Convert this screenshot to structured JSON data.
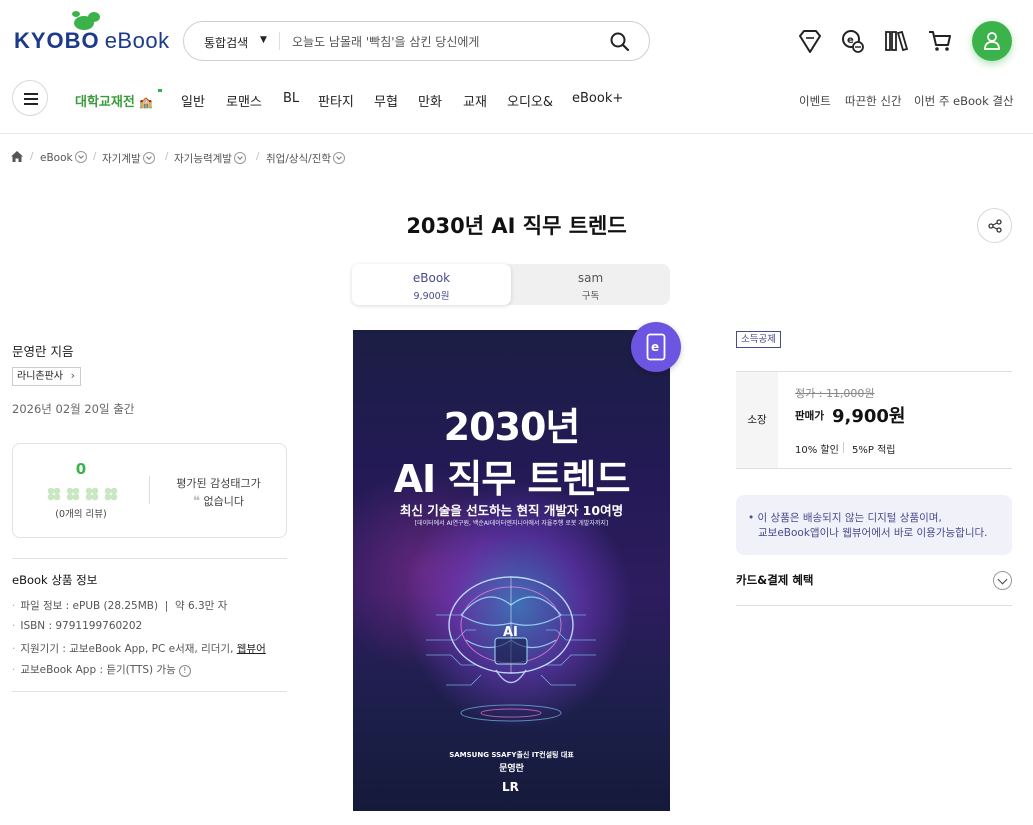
{
  "header": {
    "logo_brand": "KYOBO",
    "logo_product": "eBook",
    "search": {
      "category": "통합검색",
      "placeholder": "오늘도 남몰래 '빡침'을 삼킨 당신에게"
    },
    "icons": [
      "bookmark-ribbon-icon",
      "ecash-coin-icon",
      "library-icon",
      "cart-icon",
      "user-icon"
    ]
  },
  "nav": {
    "items": [
      "대학교재전",
      "일반",
      "로맨스",
      "BL",
      "판타지",
      "무협",
      "만화",
      "교재",
      "오디오&",
      "eBook+"
    ],
    "right_links": [
      "이벤트",
      "따끈한 신간",
      "이번 주 eBook 결산"
    ]
  },
  "breadcrumb": [
    "eBook",
    "자기계발",
    "자기능력계발",
    "취업/상식/진학"
  ],
  "product": {
    "title": "2030년 AI 직무 트렌드",
    "tabs": [
      {
        "label": "eBook",
        "sub": "9,900원"
      },
      {
        "label": "sam",
        "sub": "구독"
      }
    ],
    "author": "문영란 지음",
    "publisher": "라니촌판사",
    "pub_date": "2026년 02월 20일 출간",
    "review": {
      "score": "0",
      "rating_stars": 0,
      "count_text": "(0개의 리뷰)",
      "tag_line1": "평가된 감성태그가",
      "tag_line2": "없습니다"
    },
    "info": {
      "title": "eBook 상품 정보",
      "file": "파일 정보 : ePUB (28.25MB)",
      "file_chars": "약 6.3만 자",
      "isbn": "ISBN : 9791199760202",
      "devices_prefix": "지원기기 : 교보eBook App, PC e서재, 리더기,",
      "devices_link": "웹뷰어",
      "tts": "교보eBook App : 듣기(TTS) 가능"
    },
    "cover": {
      "line1": "2030년",
      "line2": "AI 직무 트렌드",
      "subtitle": "최신 기술을 선도하는 현직 개발자 10여명",
      "subtitle2": "[데이터에서 AI연구원, 백순AI데이터엔지니어에서 자율주행 로봇 개발자까지]",
      "ai_label": "AI",
      "author_line1": "SAMSUNG SSAFY출신 IT컨설팅 대표",
      "author_line2": "문영란",
      "publisher_mark": "LR"
    },
    "price": {
      "tax_badge": "소득공제",
      "own_label": "소장",
      "original": "정가 : 11,000원",
      "sale_label": "판매가",
      "sale": "9,900원",
      "discount": "10% 할인",
      "points": "5%P 적립"
    },
    "notice": {
      "line1": "• 이 상품은 배송되지 않는 디지털 상품이며,",
      "line2": "교보eBook앱이나 웹뷰어에서 바로 이용가능합니다."
    },
    "card_benefit": "카드&결제 혜택"
  },
  "colors": {
    "brand_blue": "#1b3a8c",
    "brand_green": "#3cb34a",
    "accent_purple": "#6c55e0",
    "accent_navy": "#4a4a8c"
  }
}
